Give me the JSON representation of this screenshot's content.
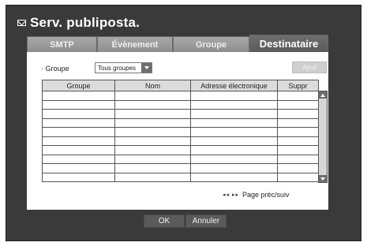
{
  "window": {
    "title": "Serv. publiposta.",
    "title_icon": "envelope-icon"
  },
  "tabs": [
    {
      "label": "SMTP",
      "active": false
    },
    {
      "label": "Évènement",
      "active": false
    },
    {
      "label": "Groupe",
      "active": false
    },
    {
      "label": "Destinataire",
      "active": true
    }
  ],
  "filter": {
    "group_label": "· Groupe",
    "group_value": "Tous groupes",
    "add_button": "Ajout"
  },
  "table": {
    "headers": [
      "Groupe",
      "Nom",
      "Adresse électronique",
      "Suppr"
    ],
    "rows": [
      [
        "",
        "",
        "",
        ""
      ],
      [
        "",
        "",
        "",
        ""
      ],
      [
        "",
        "",
        "",
        ""
      ],
      [
        "",
        "",
        "",
        ""
      ],
      [
        "",
        "",
        "",
        ""
      ],
      [
        "",
        "",
        "",
        ""
      ],
      [
        "",
        "",
        "",
        ""
      ],
      [
        "",
        "",
        "",
        ""
      ],
      [
        "",
        "",
        "",
        ""
      ],
      [
        "",
        "",
        "",
        ""
      ]
    ]
  },
  "pager": {
    "arrows": "◂◂ ▸▸",
    "label": "Page préc/suiv"
  },
  "footer": {
    "ok": "OK",
    "cancel": "Annuler"
  }
}
